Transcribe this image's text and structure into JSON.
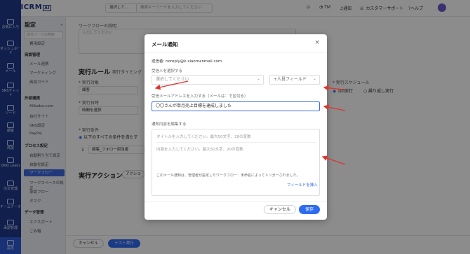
{
  "topbar": {
    "logo": "OKKICRM",
    "logo_badge": "AI",
    "search_select": "選択して...",
    "search_placeholder": "検索キーワードを入力してください",
    "user": "TM",
    "notice": "通知",
    "support": "カスタマーサポート",
    "help": "ヘルプ"
  },
  "rail": {
    "items": [
      {
        "label": "お気に入り"
      },
      {
        "label": "ダッシュボード"
      },
      {
        "label": "メール"
      },
      {
        "label": "SNSチャット"
      },
      {
        "label": "リード"
      },
      {
        "label": "顧客"
      },
      {
        "label": "商談"
      },
      {
        "label": "OKKI Leads"
      },
      {
        "label": "注文管理"
      },
      {
        "label": "チームデータ"
      },
      {
        "label": "承認管理"
      },
      {
        "label": "設定"
      }
    ]
  },
  "settings": {
    "title": "設定",
    "search_placeholder": "該当ページの検索",
    "groups": [
      {
        "label": "",
        "items": [
          "費用設定"
        ]
      },
      {
        "label": "商談管理",
        "items": [
          "メール連携",
          "マーケティング",
          "商談ガイド"
        ]
      },
      {
        "label": "外部連携",
        "items": [
          "Alibaba.com",
          "自社サイト",
          "SNS設定",
          "PayPal"
        ]
      },
      {
        "label": "プロセス設定",
        "items": [
          "自動割り当て設定",
          "自動化設定",
          "ワークフロー",
          "ワークスペースの設定",
          "承認フロー",
          "タスク"
        ]
      },
      {
        "label": "データ管理",
        "items": [
          "エクスポート",
          "ごみ箱"
        ]
      }
    ],
    "active_item": "ワークフロー"
  },
  "main": {
    "desc_label": "ワークフローの説明",
    "desc_placeholder": "入力してください",
    "rule_title": "実行ルール",
    "rule_sub": "実行タイミング",
    "target_label": "* 実行対象",
    "target_value": "顧客",
    "date_label": "* 実行日時",
    "date_value": "時間を選択",
    "cond_label": "* 実行条件",
    "cond_value": "以下のすべての条件を満たす",
    "cond_row_num": "1",
    "cond_row_value": "顧客_フォロー担当者",
    "schedule_label": "* 実行スケジュール",
    "schedule_once": "1回実行",
    "schedule_repeat": "繰り返し実行",
    "action_title": "実行アクション",
    "action_btn": "アクショ",
    "cancel_btn": "キャンセル",
    "test_btn": "テスト実行"
  },
  "modal": {
    "title": "メール通知",
    "sender_label": "送信者:",
    "sender_value": "noreply@k.xiaomanmail.com",
    "recipient_label": "受信人を選択する",
    "recipient_placeholder": "選択してください",
    "field_select": "+人員フィールド",
    "address_label": "受信メールアドレスを入力する（メールは：で区切る）",
    "subject_value": "〇〇さんが単月売上目標を達成しました",
    "body_label": "通知内容を編集する",
    "title_placeholder": "タイトルを入力してください。最大50文字、20の変数",
    "content_placeholder": "内容を入力してください。最大50文字、20の変数",
    "footer_note": "このメール通知は、管理者が設定したワークフロー：未命名によってトリガーされました。",
    "insert_field": "フィールドを挿入",
    "cancel": "キャンセル",
    "save": "保存"
  },
  "colors": {
    "rail": "#1e3a8a",
    "accent": "#2f6bf0",
    "arrow": "#e0342c"
  }
}
